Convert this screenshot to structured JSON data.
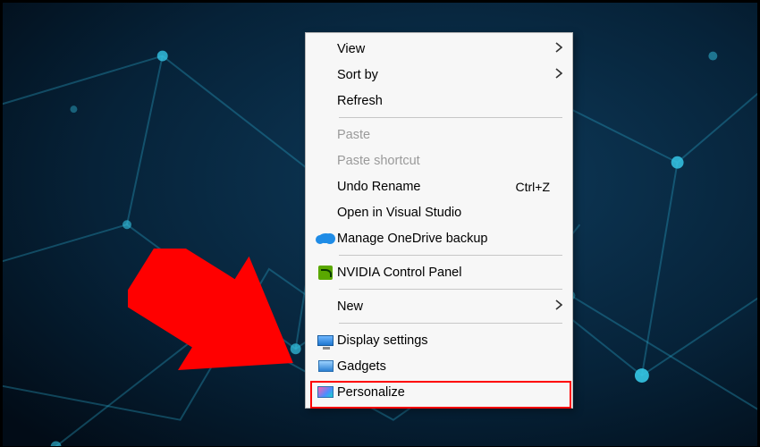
{
  "context_menu": {
    "sections": [
      [
        {
          "id": "view",
          "label": "View",
          "submenu": true,
          "icon": null,
          "enabled": true
        },
        {
          "id": "sort-by",
          "label": "Sort by",
          "submenu": true,
          "icon": null,
          "enabled": true
        },
        {
          "id": "refresh",
          "label": "Refresh",
          "submenu": false,
          "icon": null,
          "enabled": true
        }
      ],
      [
        {
          "id": "paste",
          "label": "Paste",
          "submenu": false,
          "icon": null,
          "enabled": false
        },
        {
          "id": "paste-shortcut",
          "label": "Paste shortcut",
          "submenu": false,
          "icon": null,
          "enabled": false
        },
        {
          "id": "undo-rename",
          "label": "Undo Rename",
          "submenu": false,
          "icon": null,
          "enabled": true,
          "shortcut": "Ctrl+Z"
        },
        {
          "id": "open-vs",
          "label": "Open in Visual Studio",
          "submenu": false,
          "icon": null,
          "enabled": true
        },
        {
          "id": "onedrive",
          "label": "Manage OneDrive backup",
          "submenu": false,
          "icon": "cloud",
          "enabled": true
        }
      ],
      [
        {
          "id": "nvidia",
          "label": "NVIDIA Control Panel",
          "submenu": false,
          "icon": "nvidia",
          "enabled": true
        }
      ],
      [
        {
          "id": "new",
          "label": "New",
          "submenu": true,
          "icon": null,
          "enabled": true
        }
      ],
      [
        {
          "id": "display-settings",
          "label": "Display settings",
          "submenu": false,
          "icon": "monitor",
          "enabled": true
        },
        {
          "id": "gadgets",
          "label": "Gadgets",
          "submenu": false,
          "icon": "gadgets",
          "enabled": true
        },
        {
          "id": "personalize",
          "label": "Personalize",
          "submenu": false,
          "icon": "personalize",
          "enabled": true,
          "highlighted": true
        }
      ]
    ]
  },
  "annotation": {
    "arrow_color": "#ff0000",
    "highlight_color": "#ff0000",
    "highlighted_item": "personalize"
  },
  "background": {
    "style": "dark-blue-network-plexus"
  }
}
